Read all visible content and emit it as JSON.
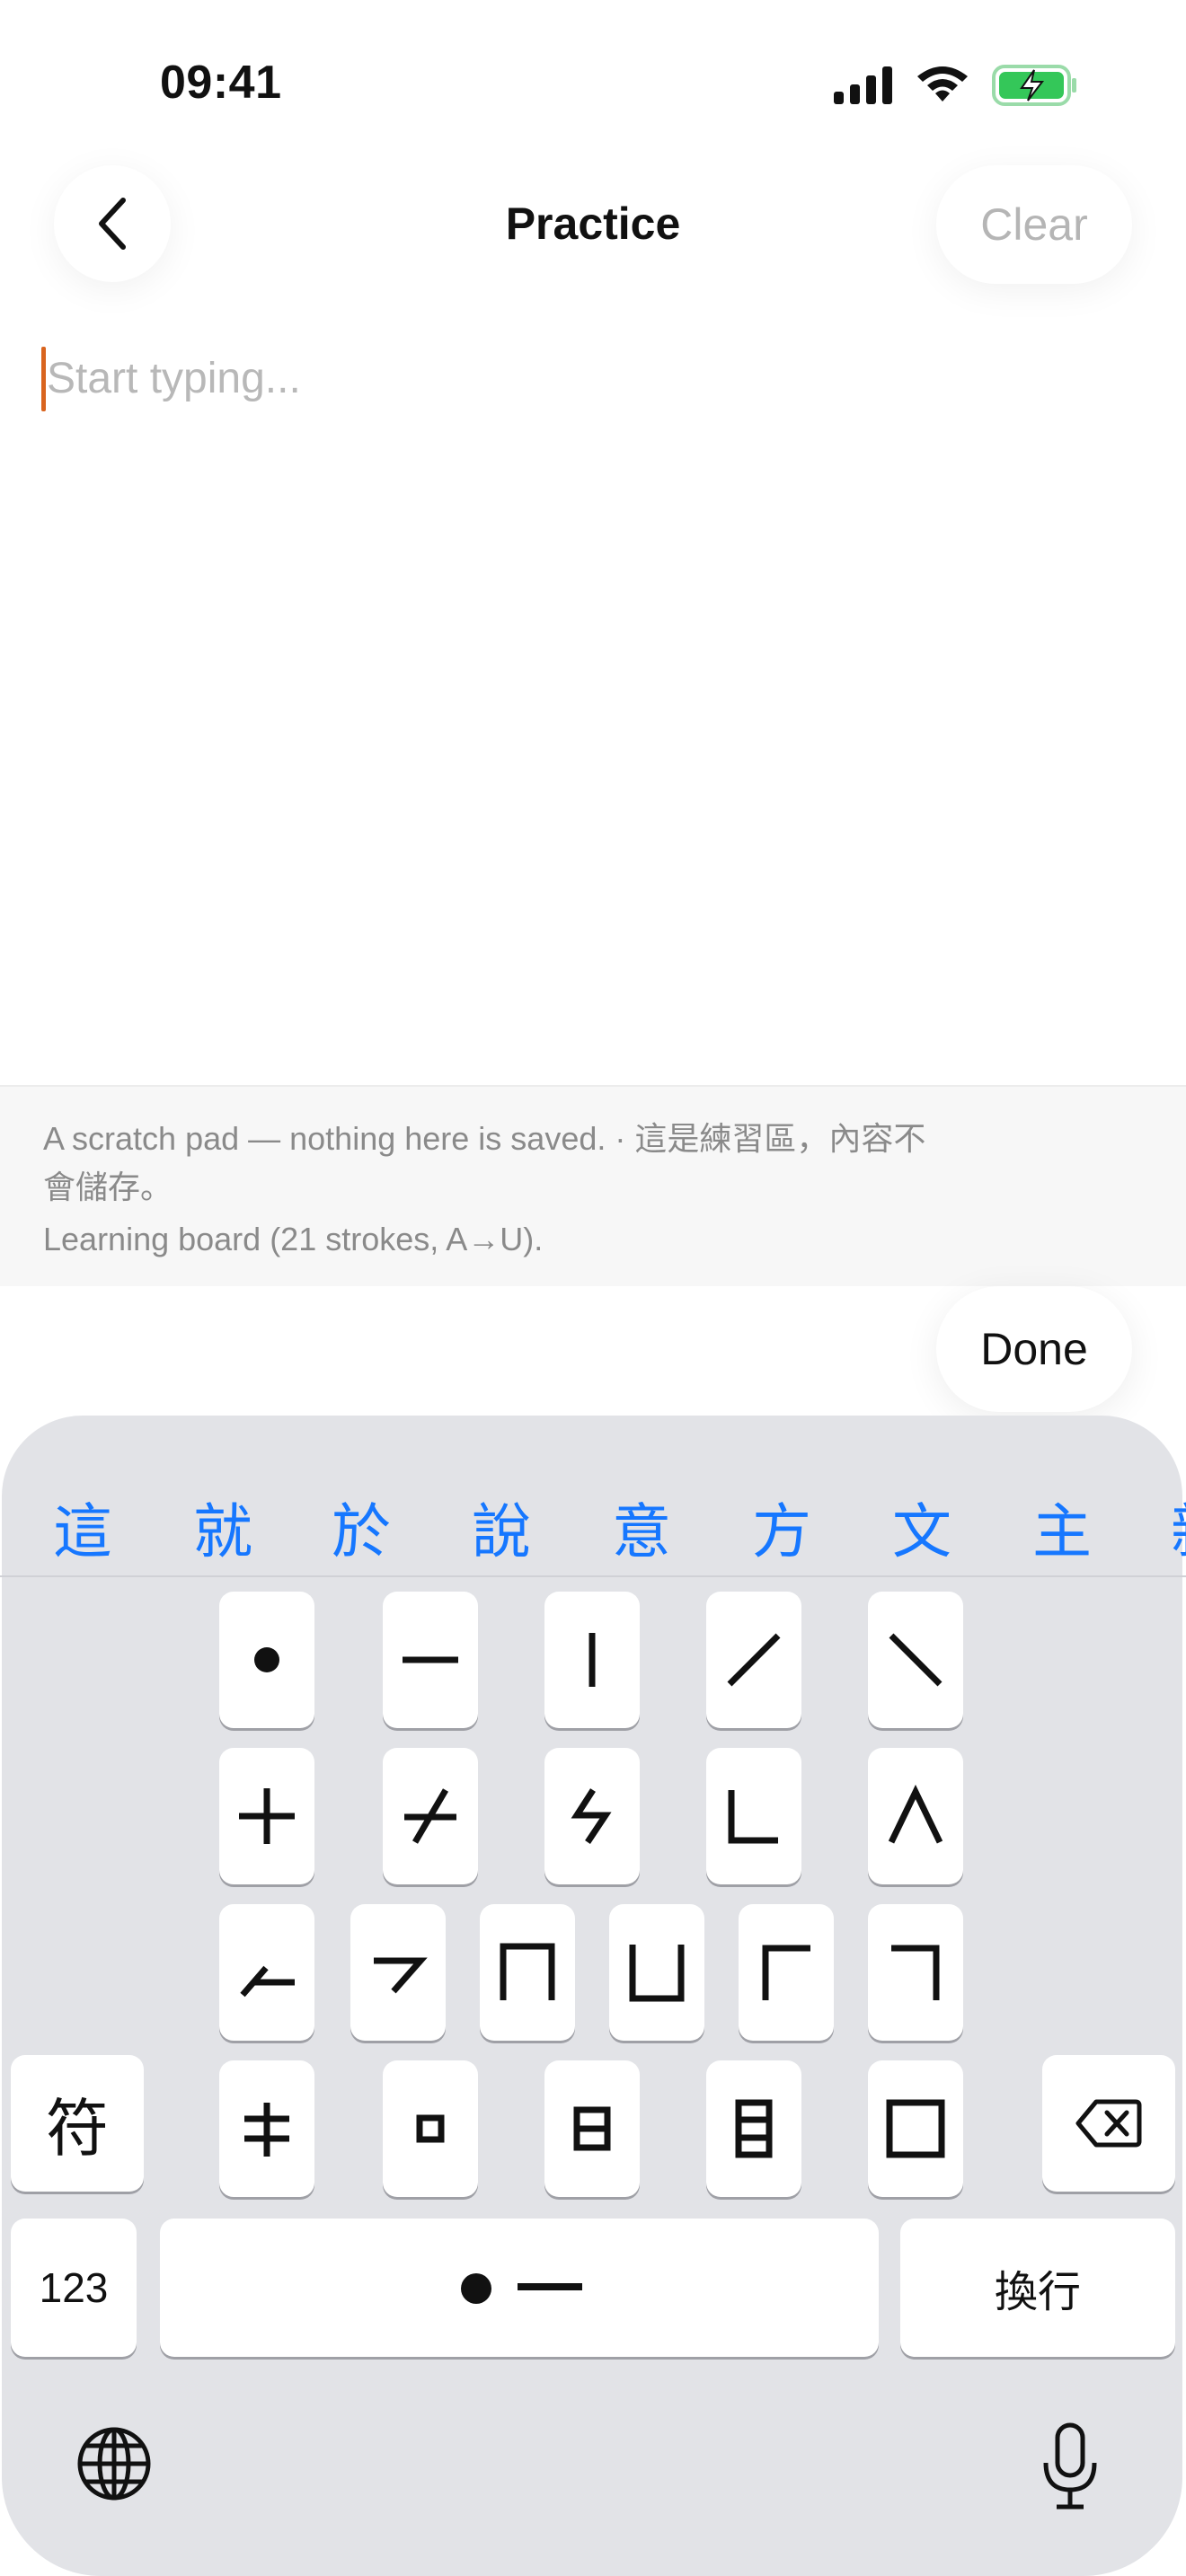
{
  "status_bar": {
    "time": "09:41",
    "icons": [
      "cellular-signal-icon",
      "wifi-icon",
      "battery-charging-icon"
    ],
    "battery_color": "#34c759"
  },
  "header": {
    "title": "Practice",
    "back_icon": "chevron-left-icon",
    "clear_label": "Clear"
  },
  "editor": {
    "placeholder": "Start typing...",
    "caret_color": "#d9641e"
  },
  "info": {
    "line1": "A scratch pad — nothing here is saved. · 這是練習區，內容不",
    "line2": "會儲存。",
    "line3": "Learning board (21 strokes, A→U)."
  },
  "done_label": "Done",
  "keyboard": {
    "candidates": [
      "這",
      "就",
      "於",
      "說",
      "意",
      "方",
      "文",
      "主",
      "新"
    ],
    "candidate_color": "#1677ff",
    "stroke_keys": [
      "dot-stroke-icon",
      "horizontal-stroke-icon",
      "vertical-stroke-icon",
      "left-falling-stroke-icon",
      "right-falling-stroke-icon",
      "cross-stroke-icon",
      "slash-cross-stroke-icon",
      "hook-stroke-icon",
      "corner-stroke-icon",
      "caret-stroke-icon",
      "rising-stroke-icon",
      "turn-stroke-icon",
      "n-frame-stroke-icon",
      "u-frame-stroke-icon",
      "left-corner-stroke-icon",
      "right-corner-stroke-icon",
      "double-cross-stroke-icon",
      "small-box-stroke-icon",
      "sun-box-stroke-icon",
      "eye-box-stroke-icon",
      "square-stroke-icon"
    ],
    "symbols_key": "符",
    "numbers_key": "123",
    "return_key": "換行",
    "space_icon": "dot-dash-space-icon",
    "delete_icon": "backspace-icon",
    "globe_icon": "globe-icon",
    "mic_icon": "microphone-icon"
  }
}
